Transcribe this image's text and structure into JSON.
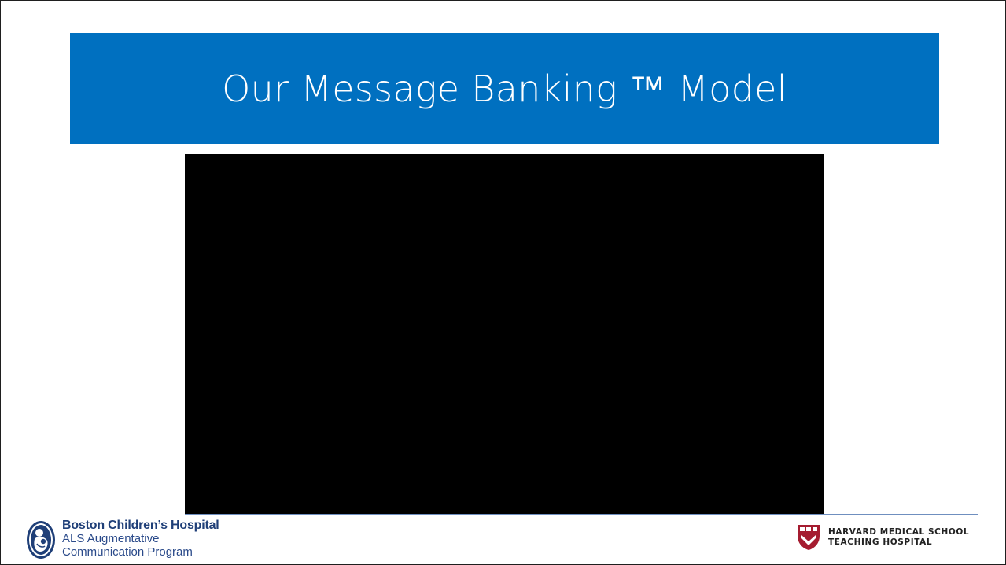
{
  "slide": {
    "title": "Our Message Banking ™ Model",
    "banner_color": "#0070c0",
    "video_color": "#000000"
  },
  "footer": {
    "left_logo": {
      "icon": "boston-childrens-hospital-emblem",
      "name": "Boston Children’s Hospital",
      "subtitle_line1": "ALS Augmentative",
      "subtitle_line2": "Communication Program",
      "color": "#1f3f78"
    },
    "right_logo": {
      "icon": "harvard-shield",
      "line1": "HARVARD MEDICAL SCHOOL",
      "line2": "TEACHING HOSPITAL",
      "shield_color": "#a51c30"
    }
  }
}
